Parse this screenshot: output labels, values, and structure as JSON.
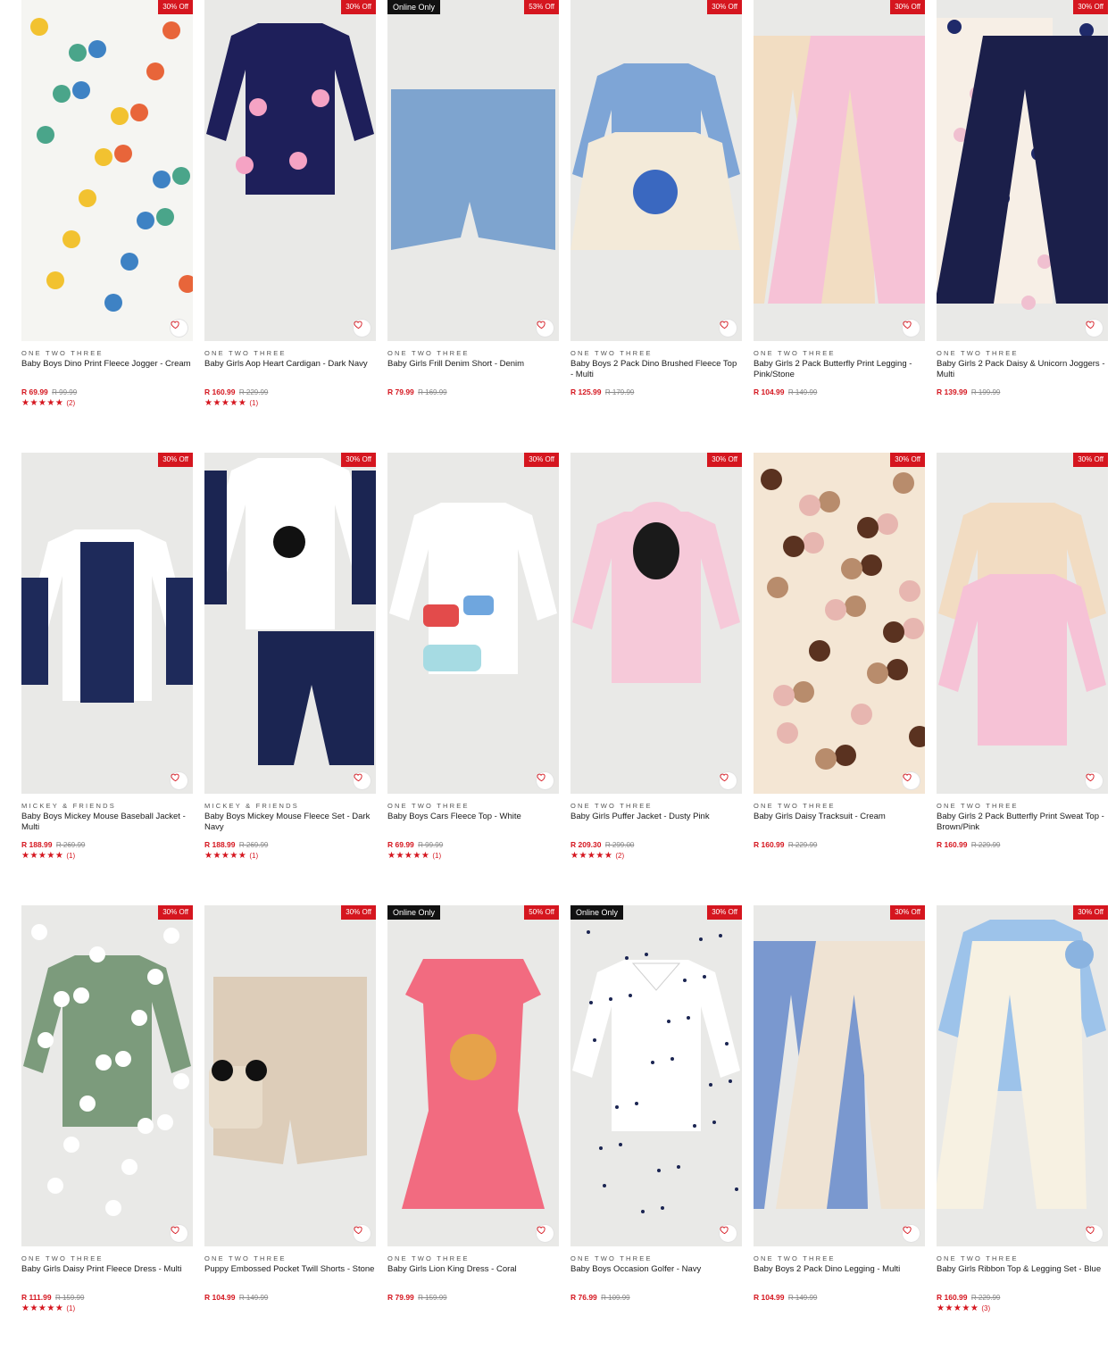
{
  "wishlist_icon": "heart-outline-icon",
  "colors": {
    "badge": "#d5161f",
    "online_badge": "#111111",
    "price": "#d5161f",
    "image_bg": "#e9e9e7"
  },
  "rows": [
    [
      {
        "badge": "30% Off",
        "online": "",
        "brand": "ONE TWO THREE",
        "title": "Baby Boys Dino Print Fleece Jogger - Cream",
        "price": "R 69.99",
        "was": "R 99.99",
        "stars": "★★★★★",
        "reviews": "(2)",
        "art": "dino-jogger"
      },
      {
        "badge": "30% Off",
        "online": "",
        "brand": "ONE TWO THREE",
        "title": "Baby Girls Aop Heart Cardigan - Dark Navy",
        "price": "R 160.99",
        "was": "R 229.99",
        "stars": "★★★★★",
        "reviews": "(1)",
        "art": "heart-cardigan"
      },
      {
        "badge": "53% Off",
        "online": "Online Only",
        "brand": "ONE TWO THREE",
        "title": "Baby Girls Frill Denim Short - Denim",
        "price": "R 79.99",
        "was": "R 169.99",
        "stars": "",
        "reviews": "",
        "art": "denim-short"
      },
      {
        "badge": "30% Off",
        "online": "",
        "brand": "ONE TWO THREE",
        "title": "Baby Boys 2 Pack Dino Brushed Fleece Top - Multi",
        "price": "R 125.99",
        "was": "R 179.99",
        "stars": "",
        "reviews": "",
        "art": "dino-tops"
      },
      {
        "badge": "30% Off",
        "online": "",
        "brand": "ONE TWO THREE",
        "title": "Baby Girls 2 Pack Butterfly Print Legging - Pink/Stone",
        "price": "R 104.99",
        "was": "R 149.99",
        "stars": "",
        "reviews": "",
        "art": "butterfly-legging"
      },
      {
        "badge": "30% Off",
        "online": "",
        "brand": "ONE TWO THREE",
        "title": "Baby Girls 2 Pack Daisy & Unicorn Joggers - Multi",
        "price": "R 139.99",
        "was": "R 199.99",
        "stars": "",
        "reviews": "",
        "art": "daisy-joggers"
      }
    ],
    [
      {
        "badge": "30% Off",
        "online": "",
        "brand": "MICKEY & FRIENDS",
        "title": "Baby Boys Mickey Mouse Baseball Jacket - Multi",
        "price": "R 188.99",
        "was": "R 269.99",
        "stars": "★★★★★",
        "reviews": "(1)",
        "art": "baseball-jacket"
      },
      {
        "badge": "30% Off",
        "online": "",
        "brand": "MICKEY & FRIENDS",
        "title": "Baby Boys Mickey Mouse Fleece Set - Dark Navy",
        "price": "R 188.99",
        "was": "R 269.99",
        "stars": "★★★★★",
        "reviews": "(1)",
        "art": "mickey-set"
      },
      {
        "badge": "30% Off",
        "online": "",
        "brand": "ONE TWO THREE",
        "title": "Baby Boys Cars Fleece Top - White",
        "price": "R 69.99",
        "was": "R 99.99",
        "stars": "★★★★★",
        "reviews": "(1)",
        "art": "cars-top"
      },
      {
        "badge": "30% Off",
        "online": "",
        "brand": "ONE TWO THREE",
        "title": "Baby Girls Puffer Jacket - Dusty Pink",
        "price": "R 209.30",
        "was": "R 299.00",
        "stars": "★★★★★",
        "reviews": "(2)",
        "art": "puffer-jacket"
      },
      {
        "badge": "30% Off",
        "online": "",
        "brand": "ONE TWO THREE",
        "title": "Baby Girls Daisy Tracksuit - Cream",
        "price": "R 160.99",
        "was": "R 229.99",
        "stars": "",
        "reviews": "",
        "art": "daisy-tracksuit"
      },
      {
        "badge": "30% Off",
        "online": "",
        "brand": "ONE TWO THREE",
        "title": "Baby Girls 2 Pack Butterfly Print Sweat Top - Brown/Pink",
        "price": "R 160.99",
        "was": "R 229.99",
        "stars": "",
        "reviews": "",
        "art": "butterfly-sweat"
      }
    ],
    [
      {
        "badge": "30% Off",
        "online": "",
        "brand": "ONE TWO THREE",
        "title": "Baby Girls Daisy Print Fleece Dress - Multi",
        "price": "R 111.99",
        "was": "R 159.99",
        "stars": "★★★★★",
        "reviews": "(1)",
        "art": "daisy-dress"
      },
      {
        "badge": "30% Off",
        "online": "",
        "brand": "ONE TWO THREE",
        "title": "Puppy Embossed Pocket Twill Shorts - Stone",
        "price": "R 104.99",
        "was": "R 149.99",
        "stars": "",
        "reviews": "",
        "art": "twill-shorts"
      },
      {
        "badge": "50% Off",
        "online": "Online Only",
        "brand": "ONE TWO THREE",
        "title": "Baby Girls Lion King Dress - Coral",
        "price": "R 79.99",
        "was": "R 159.99",
        "stars": "",
        "reviews": "",
        "art": "lion-dress"
      },
      {
        "badge": "30% Off",
        "online": "Online Only",
        "brand": "ONE TWO THREE",
        "title": "Baby Boys Occasion Golfer - Navy",
        "price": "R 76.99",
        "was": "R 109.99",
        "stars": "",
        "reviews": "",
        "art": "golfer"
      },
      {
        "badge": "30% Off",
        "online": "",
        "brand": "ONE TWO THREE",
        "title": "Baby Boys 2 Pack Dino Legging - Multi",
        "price": "R 104.99",
        "was": "R 149.99",
        "stars": "",
        "reviews": "",
        "art": "dino-legging"
      },
      {
        "badge": "30% Off",
        "online": "",
        "brand": "ONE TWO THREE",
        "title": "Baby Girls Ribbon Top & Legging Set - Blue",
        "price": "R 160.99",
        "was": "R 229.99",
        "stars": "★★★★★",
        "reviews": "(3)",
        "art": "ribbon-set"
      }
    ]
  ]
}
